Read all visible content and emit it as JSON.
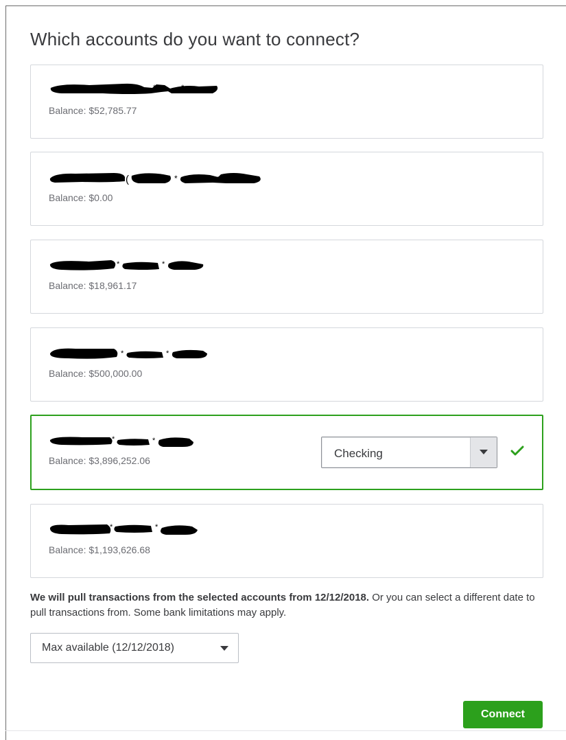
{
  "dialog": {
    "title": "Which accounts do you want to connect?"
  },
  "accounts": [
    {
      "name": "",
      "balance_label": "Balance: $52,785.77",
      "selected": false
    },
    {
      "name": "",
      "balance_label": "Balance: $0.00",
      "selected": false
    },
    {
      "name": "",
      "balance_label": "Balance: $18,961.17",
      "selected": false
    },
    {
      "name": "",
      "balance_label": "Balance: $500,000.00",
      "selected": false
    },
    {
      "name": "",
      "balance_label": "Balance: $3,896,252.06",
      "selected": true,
      "account_type": "Checking"
    },
    {
      "name": "",
      "balance_label": "Balance: $1,193,626.68",
      "selected": false
    }
  ],
  "transactions_note": {
    "bold": "We will pull transactions from the selected accounts from 12/12/2018.",
    "rest": " Or you can select a different date to pull transactions from. Some bank limitations may apply."
  },
  "date_select": {
    "value": "Max available (12/12/2018)"
  },
  "actions": {
    "connect_label": "Connect"
  },
  "icons": {
    "account_type_dropdown": "caret-down-icon",
    "selected_indicator": "checkmark-icon",
    "date_dropdown": "caret-down-icon"
  },
  "colors": {
    "accent_green": "#2ca01c",
    "text_primary": "#393a3d",
    "text_secondary": "#6b6c72",
    "card_border": "#d4d7dc",
    "redaction": "#000000"
  }
}
